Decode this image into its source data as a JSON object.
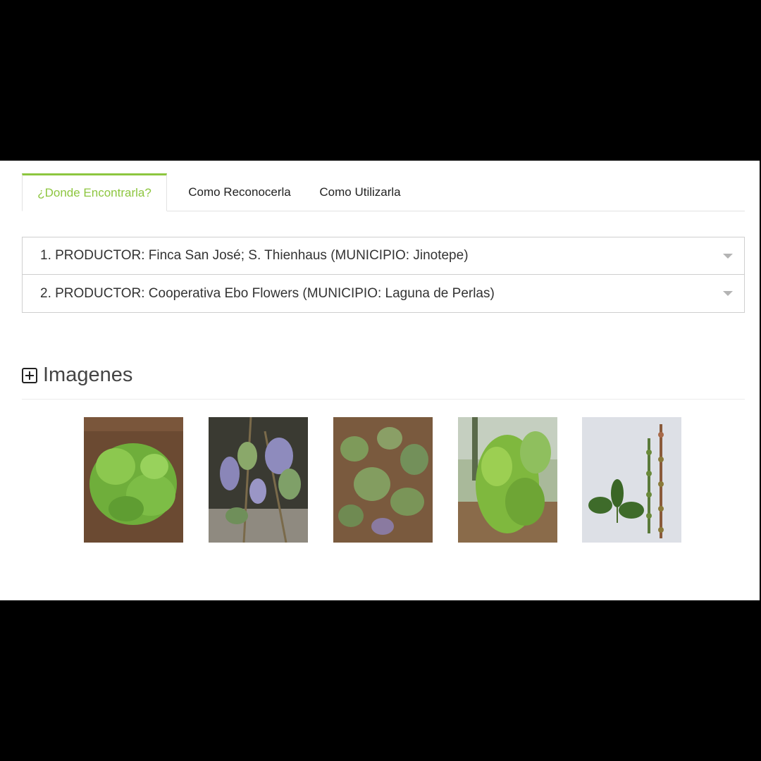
{
  "tabs": [
    {
      "label": "¿Donde Encontrarla?",
      "active": true
    },
    {
      "label": "Como Reconocerla",
      "active": false
    },
    {
      "label": "Como Utilizarla",
      "active": false
    }
  ],
  "accordion": {
    "items": [
      {
        "label": "1. PRODUCTOR: Finca San José; S. Thienhaus (MUNICIPIO: Jinotepe)"
      },
      {
        "label": "2. PRODUCTOR: Cooperativa Ebo Flowers (MUNICIPIO: Laguna de Perlas)"
      }
    ]
  },
  "images": {
    "title": "Imagenes",
    "icon": "plus-square-icon",
    "thumbnails": [
      {
        "name": "plant-photo-1"
      },
      {
        "name": "plant-photo-2"
      },
      {
        "name": "plant-photo-3"
      },
      {
        "name": "plant-photo-4"
      },
      {
        "name": "plant-photo-5"
      }
    ]
  },
  "colors": {
    "accent": "#8dc63f",
    "background": "#ffffff",
    "letterbox": "#000000"
  }
}
